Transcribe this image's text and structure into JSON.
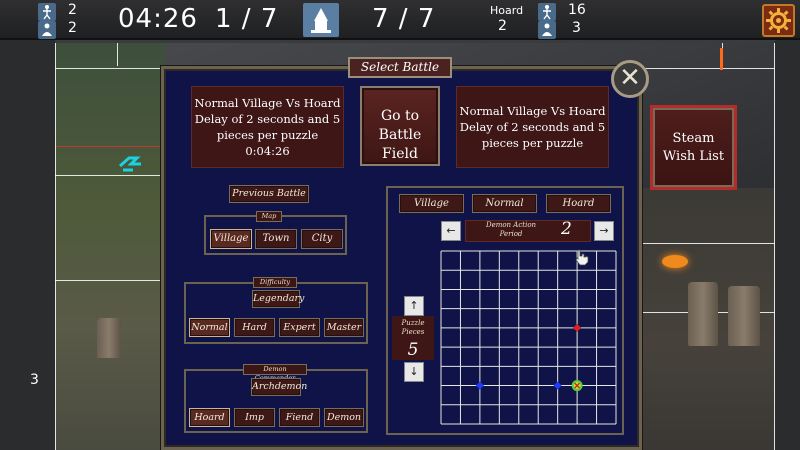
{
  "hud": {
    "left_top_value": "2",
    "left_bottom_value": "2",
    "timer": "04:26",
    "progress_a": "1 / 7",
    "progress_b": "7 / 7",
    "hoard_label": "Hoard",
    "hoard_value": "2",
    "right_top_value": "16",
    "right_bottom_value": "3",
    "icons": [
      "human-icon",
      "villager-icon",
      "tower-icon",
      "human-icon",
      "villager-icon",
      "gear-icon"
    ]
  },
  "side_number": "3",
  "dialog": {
    "title": "Select Battle",
    "close_symbol": "✕",
    "current_battle": {
      "line1": "Normal Village Vs Hoard",
      "line2": "Delay of 2 seconds and 5",
      "line3": "pieces per puzzle",
      "line4": "0:04:26"
    },
    "go_button": {
      "line1": "Go to",
      "line2": "Battle Field"
    },
    "next_battle": {
      "line1": "Normal Village Vs Hoard",
      "line2": "Delay of 2 seconds and 5",
      "line3": "pieces per puzzle"
    },
    "previous_battle_label": "Previous Battle",
    "map": {
      "label": "Map",
      "options": [
        "Village",
        "Town",
        "City"
      ],
      "selected": "Village"
    },
    "difficulty": {
      "label": "Difficulty",
      "top_option": "Legendary",
      "options": [
        "Normal",
        "Hard",
        "Expert",
        "Master"
      ],
      "selected": "Normal"
    },
    "demon_commander": {
      "label": "Demon Commander",
      "top_option": "Archdemon",
      "options": [
        "Hoard",
        "Imp",
        "Fiend",
        "Demon"
      ],
      "selected": "Hoard"
    },
    "summary_tabs": [
      "Village",
      "Normal",
      "Hoard"
    ],
    "demon_action_period": {
      "label_line1": "Demon Action",
      "label_line2": "Period",
      "value": "2",
      "left_arrow": "←",
      "right_arrow": "→"
    },
    "puzzle_pieces": {
      "label_line1": "Puzzle",
      "label_line2": "Pieces",
      "value": "5",
      "up_arrow": "↑",
      "down_arrow": "↓"
    },
    "puzzle_grid": {
      "columns": 9,
      "rows": 9,
      "markers": [
        {
          "col": 7,
          "row": 4,
          "color": "#e02020"
        },
        {
          "col": 2,
          "row": 7,
          "color": "#1f3cff"
        },
        {
          "col": 6,
          "row": 7,
          "color": "#1f3cff"
        },
        {
          "col": 7,
          "row": 7,
          "color": "#4cd13a",
          "kind": "target"
        }
      ]
    }
  },
  "steam_button": {
    "line1": "Steam",
    "line2": "Wish List"
  },
  "colors": {
    "dialog_bg": "#0f1347",
    "panel_bg": "#3d1615",
    "frame": "#6b6250",
    "steam_border": "#b22c2c"
  }
}
